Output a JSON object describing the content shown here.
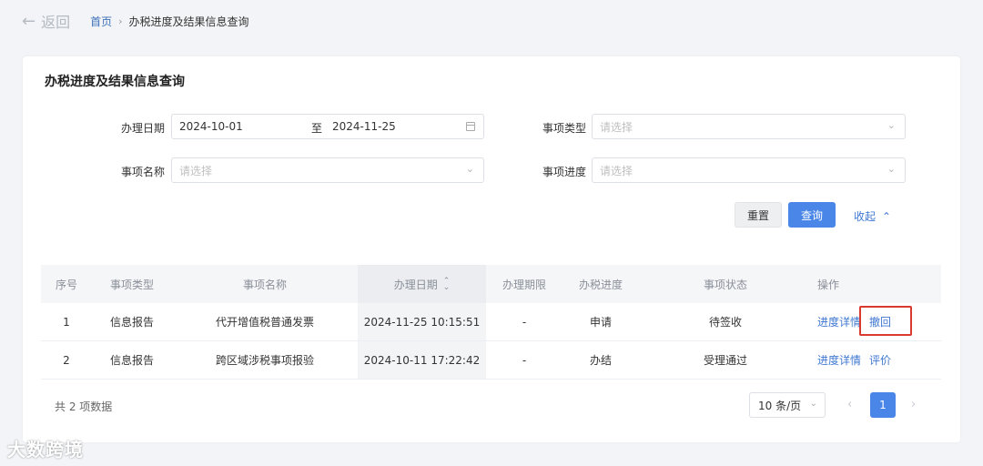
{
  "nav": {
    "back_label": "返回",
    "crumb_home": "首页",
    "crumb_current": "办税进度及结果信息查询"
  },
  "card": {
    "title": "办税进度及结果信息查询"
  },
  "filters": {
    "date_label": "办理日期",
    "date_from": "2024-10-01",
    "date_to_sep": "至",
    "date_to": "2024-11-25",
    "type_label": "事项类型",
    "type_placeholder": "请选择",
    "name_label": "事项名称",
    "name_placeholder": "请选择",
    "progress_label": "事项进度",
    "progress_placeholder": "请选择"
  },
  "actions": {
    "reset": "重置",
    "query": "查询",
    "collapse": "收起"
  },
  "table": {
    "headers": [
      "序号",
      "事项类型",
      "事项名称",
      "办理日期",
      "办理期限",
      "办税进度",
      "事项状态",
      "操作"
    ],
    "rows": [
      {
        "no": "1",
        "type": "信息报告",
        "name": "代开增值税普通发票",
        "date": "2024-11-25 10:15:51",
        "deadline": "-",
        "progress": "申请",
        "status": "待签收",
        "op1": "进度详情",
        "op2": "撤回"
      },
      {
        "no": "2",
        "type": "信息报告",
        "name": "跨区域涉税事项报验",
        "date": "2024-10-11 17:22:42",
        "deadline": "-",
        "progress": "办结",
        "status": "受理通过",
        "op1": "进度详情",
        "op2": "评价"
      }
    ]
  },
  "pagination": {
    "total_text": "共 2 项数据",
    "page_size": "10 条/页",
    "current_page": "1"
  },
  "watermark": "大数跨境",
  "colors": {
    "primary": "#4a86e8",
    "link": "#3f78d2",
    "highlight_box": "#d93a2f"
  }
}
